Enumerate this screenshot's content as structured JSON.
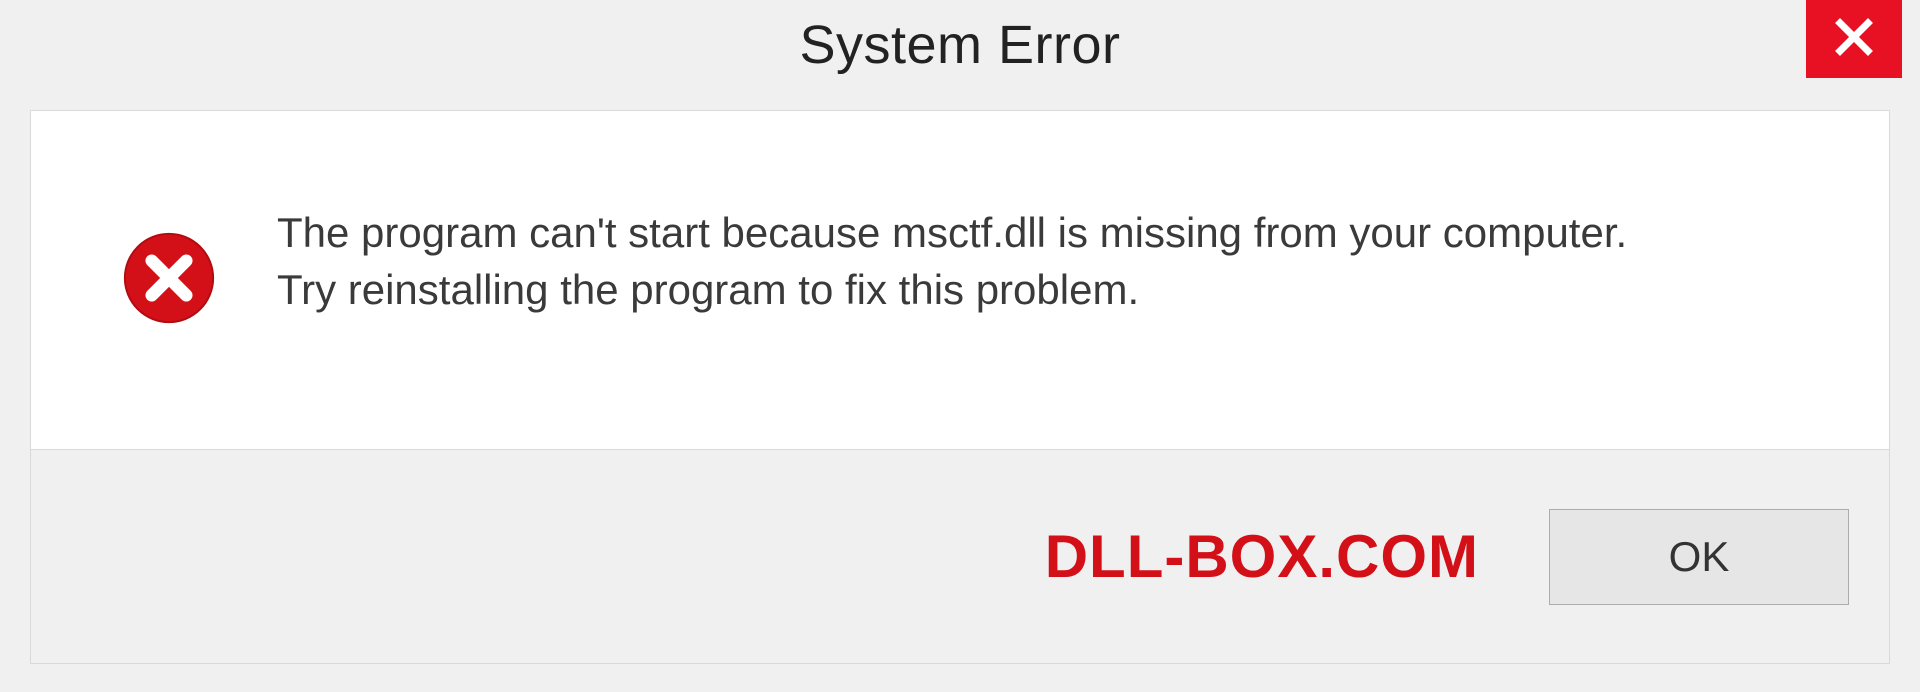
{
  "dialog": {
    "title": "System Error",
    "message_line1": "The program can't start because msctf.dll is missing from your computer.",
    "message_line2": "Try reinstalling the program to fix this problem.",
    "ok_label": "OK"
  },
  "watermark": {
    "text": "DLL-BOX.COM"
  },
  "colors": {
    "close_bg": "#e81123",
    "error_icon": "#d30f17",
    "watermark": "#d30f17"
  }
}
